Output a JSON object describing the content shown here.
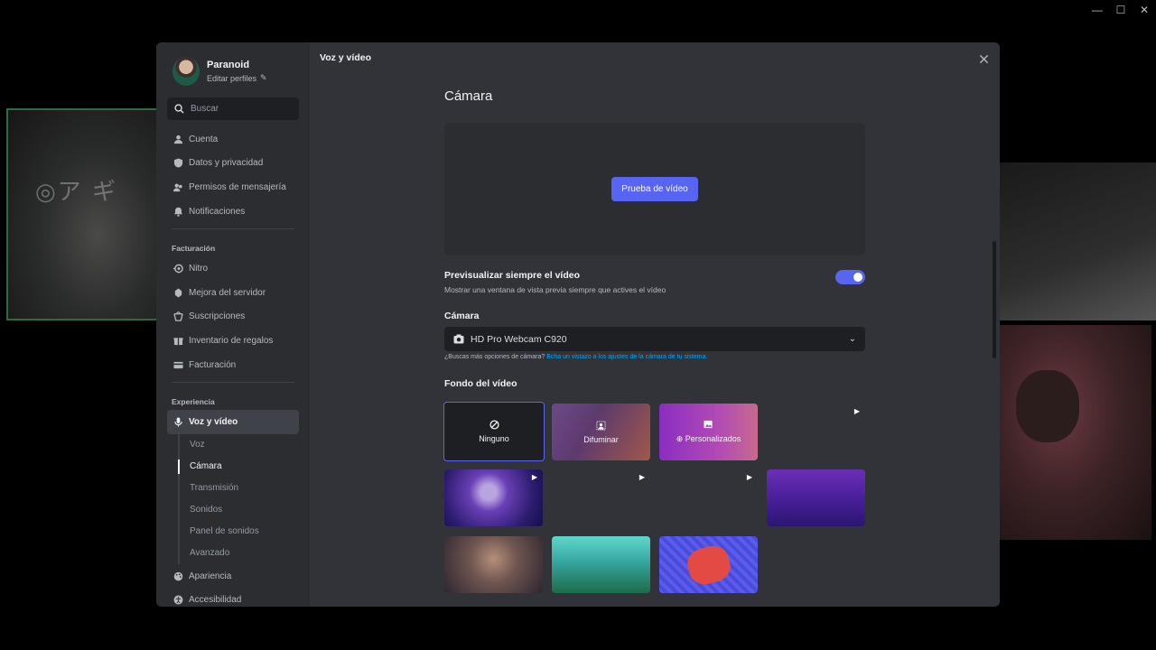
{
  "profile": {
    "name": "Paranoid",
    "edit_label": "Editar perfiles"
  },
  "search": {
    "placeholder": "Buscar"
  },
  "nav": {
    "group1": [
      "Cuenta",
      "Datos y privacidad",
      "Permisos de mensajería",
      "Notificaciones"
    ],
    "billing_header": "Facturación",
    "group2": [
      "Nitro",
      "Mejora del servidor",
      "Suscripciones",
      "Inventario de regalos",
      "Facturación"
    ],
    "experience_header": "Experiencia",
    "active": "Voz y vídeo",
    "sub": [
      "Voz",
      "Cámara",
      "Transmisión",
      "Sonidos",
      "Panel de sonidos",
      "Avanzado"
    ],
    "group3": [
      "Apariencia",
      "Accesibilidad"
    ]
  },
  "main": {
    "title": "Voz y vídeo",
    "section_title": "Cámara",
    "test_button": "Prueba de vídeo",
    "preview_label": "Previsualizar siempre el vídeo",
    "preview_desc": "Mostrar una ventana de vista previa siempre que actives el vídeo",
    "preview_on": true,
    "camera_label": "Cámara",
    "camera_value": "HD Pro Webcam C920",
    "hint_text": "¿Buscas más opciones de cámara?",
    "hint_link": "Echa un vistazo a los ajustes de la cámara de tu sistema.",
    "background_label": "Fondo del vídeo",
    "bg_none": "Ninguno",
    "bg_blur": "Difuminar",
    "bg_custom": "Personalizados"
  },
  "colors": {
    "accent": "#5865f2",
    "link": "#00a8fc",
    "bg_main": "#313338",
    "bg_sidebar": "#2b2d31"
  }
}
